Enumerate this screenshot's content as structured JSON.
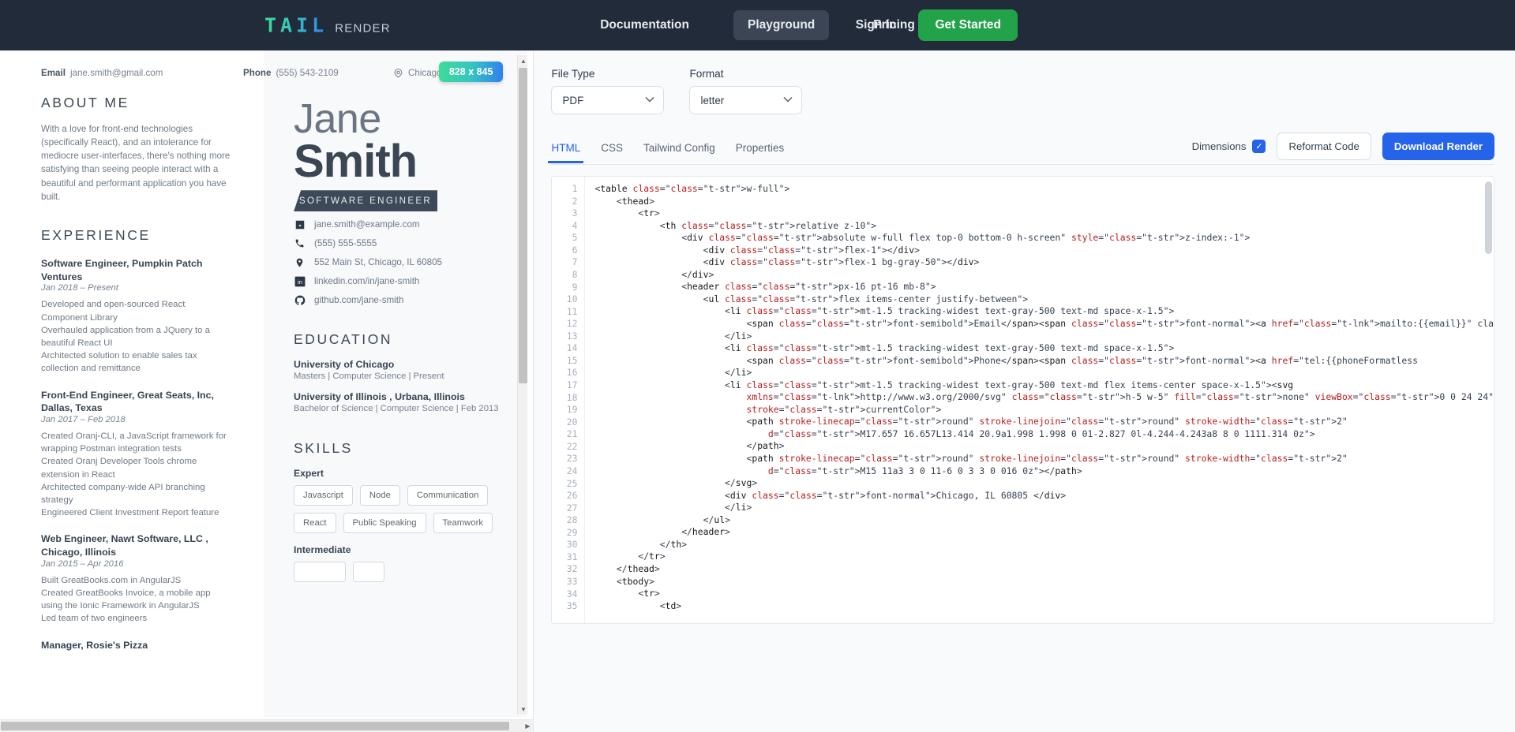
{
  "nav": {
    "brand_main": "TAIL",
    "brand_sub": "RENDER",
    "links": [
      {
        "label": "Documentation",
        "active": false
      },
      {
        "label": "Playground",
        "active": true
      },
      {
        "label": "Pricing",
        "active": false
      }
    ],
    "sign_in": "Sign In",
    "get_started": "Get Started",
    "colors": {
      "bar": "#222b3a",
      "cta": "#22a34a",
      "accent": "#2563eb"
    }
  },
  "preview": {
    "dimensions_badge": "828 x 845",
    "scroll_arrow_up": "▲",
    "scroll_arrow_down": "▼",
    "scroll_arrow_right": "▶"
  },
  "resume": {
    "topbar": [
      {
        "label": "Email",
        "value": "jane.smith@gmail.com",
        "icon": ""
      },
      {
        "label": "Phone",
        "value": "(555) 543-2109",
        "icon": ""
      },
      {
        "label": "",
        "value": "Chicago, IL 60805",
        "icon": "map-pin-icon"
      }
    ],
    "about": {
      "heading": "ABOUT ME",
      "text": "With a love for front-end technologies (specifically React), and an intolerance for mediocre user-interfaces, there's nothing more satisfying than seeing people interact with a beautiful and performant application you have built."
    },
    "experience": {
      "heading": "EXPERIENCE",
      "jobs": [
        {
          "title": "Software Engineer, Pumpkin Patch Ventures",
          "date": "Jan 2018 – Present",
          "bullets": "Developed and open-sourced React Component Library\nOverhauled application from a JQuery to a beautiful React UI\nArchitected solution to enable sales tax collection and remittance"
        },
        {
          "title": "Front-End Engineer, Great Seats, Inc, Dallas, Texas",
          "date": "Jan 2017 – Feb 2018",
          "bullets": "Created Oranj-CLI, a JavaScript framework for wrapping Postman integration tests\nCreated Oranj Developer Tools chrome extension in React\nArchitected company-wide API branching strategy\nEngineered Client Investment Report feature"
        },
        {
          "title": "Web Engineer, Nawt Software, LLC , Chicago, Illinois",
          "date": "Jan 2015 – Apr 2016",
          "bullets": "Built GreatBooks.com in AngularJS\nCreated GreatBooks Invoice, a mobile app using the Ionic Framework in AngularJS\nLed team of two engineers"
        },
        {
          "title": "Manager, Rosie's Pizza",
          "date": "",
          "bullets": ""
        }
      ]
    },
    "profile": {
      "first_name": "Jane",
      "last_name": "Smith",
      "role": "SOFTWARE ENGINEER",
      "contacts": [
        {
          "icon": "inbox-download-icon",
          "value": "jane.smith@example.com"
        },
        {
          "icon": "phone-icon",
          "value": "(555) 555-5555"
        },
        {
          "icon": "map-pin-icon",
          "value": "552 Main St, Chicago, IL 60805"
        },
        {
          "icon": "linkedin-icon",
          "value": "linkedin.com/in/jane-smith"
        },
        {
          "icon": "github-icon",
          "value": "github.com/jane-smith"
        }
      ]
    },
    "education": {
      "heading": "EDUCATION",
      "entries": [
        {
          "school": "University of Chicago",
          "detail": "Masters | Computer Science | Present"
        },
        {
          "school": "University of Illinois , Urbana, Illinois",
          "detail": "Bachelor of Science | Computer Science | Feb 2013"
        }
      ]
    },
    "skills": {
      "heading": "SKILLS",
      "groups": [
        {
          "level": "Expert",
          "tags": [
            "Javascript",
            "Node",
            "Communication",
            "React",
            "Public Speaking",
            "Teamwork"
          ]
        },
        {
          "level": "Intermediate",
          "tags": [
            "",
            ""
          ]
        }
      ]
    }
  },
  "editor": {
    "file_type": {
      "label": "File Type",
      "value": "PDF"
    },
    "format": {
      "label": "Format",
      "value": "letter"
    },
    "chevron": "⌄",
    "tabs": [
      {
        "label": "HTML",
        "active": true
      },
      {
        "label": "CSS",
        "active": false
      },
      {
        "label": "Tailwind Config",
        "active": false
      },
      {
        "label": "Properties",
        "active": false
      }
    ],
    "dimensions_label": "Dimensions",
    "dimensions_checked": "✓",
    "reformat_label": "Reformat Code",
    "download_label": "Download Render",
    "line_numbers": [
      1,
      2,
      3,
      4,
      5,
      6,
      7,
      8,
      9,
      10,
      11,
      12,
      13,
      14,
      15,
      16,
      17,
      18,
      19,
      20,
      21,
      22,
      23,
      24,
      25,
      26,
      27,
      28,
      29,
      30,
      31,
      32,
      33,
      34,
      35
    ],
    "code_lines": [
      "<table class=\"w-full\">",
      "    <thead>",
      "        <tr>",
      "            <th class=\"relative z-10\">",
      "                <div class=\"absolute w-full flex top-0 bottom-0 h-screen\" style=\"z-index:-1\">",
      "                    <div class=\"flex-1\"></div>",
      "                    <div class=\"flex-1 bg-gray-50\"></div>",
      "                </div>",
      "                <header class=\"px-16 pt-16 mb-8\">",
      "                    <ul class=\"flex items-center justify-between\">",
      "                        <li class=\"mt-1.5 tracking-widest text-gray-500 text-md space-x-1.5\">",
      "                            <span class=\"font-semibold\">Email</span><span class=\"font-normal\"><a href=\"mailto:{{email}}\" cla",
      "                        </li>",
      "                        <li class=\"mt-1.5 tracking-widest text-gray-500 text-md space-x-1.5\">",
      "                            <span class=\"font-semibold\">Phone</span><span class=\"font-normal\"><a href=\"tel:{{phoneFormatless",
      "                        </li>",
      "                        <li class=\"mt-1.5 tracking-widest text-gray-500 text-md flex items-center space-x-1.5\"><svg",
      "                            xmlns=\"http://www.w3.org/2000/svg\" class=\"h-5 w-5\" fill=\"none\" viewBox=\"0 0 24 24\"",
      "                            stroke=\"currentColor\">",
      "                            <path stroke-linecap=\"round\" stroke-linejoin=\"round\" stroke-width=\"2\"",
      "                                d=\"M17.657 16.657L13.414 20.9a1.998 1.998 0 01-2.827 0l-4.244-4.243a8 8 0 1111.314 0z\">",
      "                            </path>",
      "                            <path stroke-linecap=\"round\" stroke-linejoin=\"round\" stroke-width=\"2\"",
      "                                d=\"M15 11a3 3 0 11-6 0 3 3 0 016 0z\"></path>",
      "                        </svg>",
      "                        <div class=\"font-normal\">Chicago, IL 60805 </div>",
      "                        </li>",
      "                    </ul>",
      "                </header>",
      "            </th>",
      "        </tr>",
      "    </thead>",
      "    <tbody>",
      "        <tr>",
      "            <td>"
    ]
  }
}
